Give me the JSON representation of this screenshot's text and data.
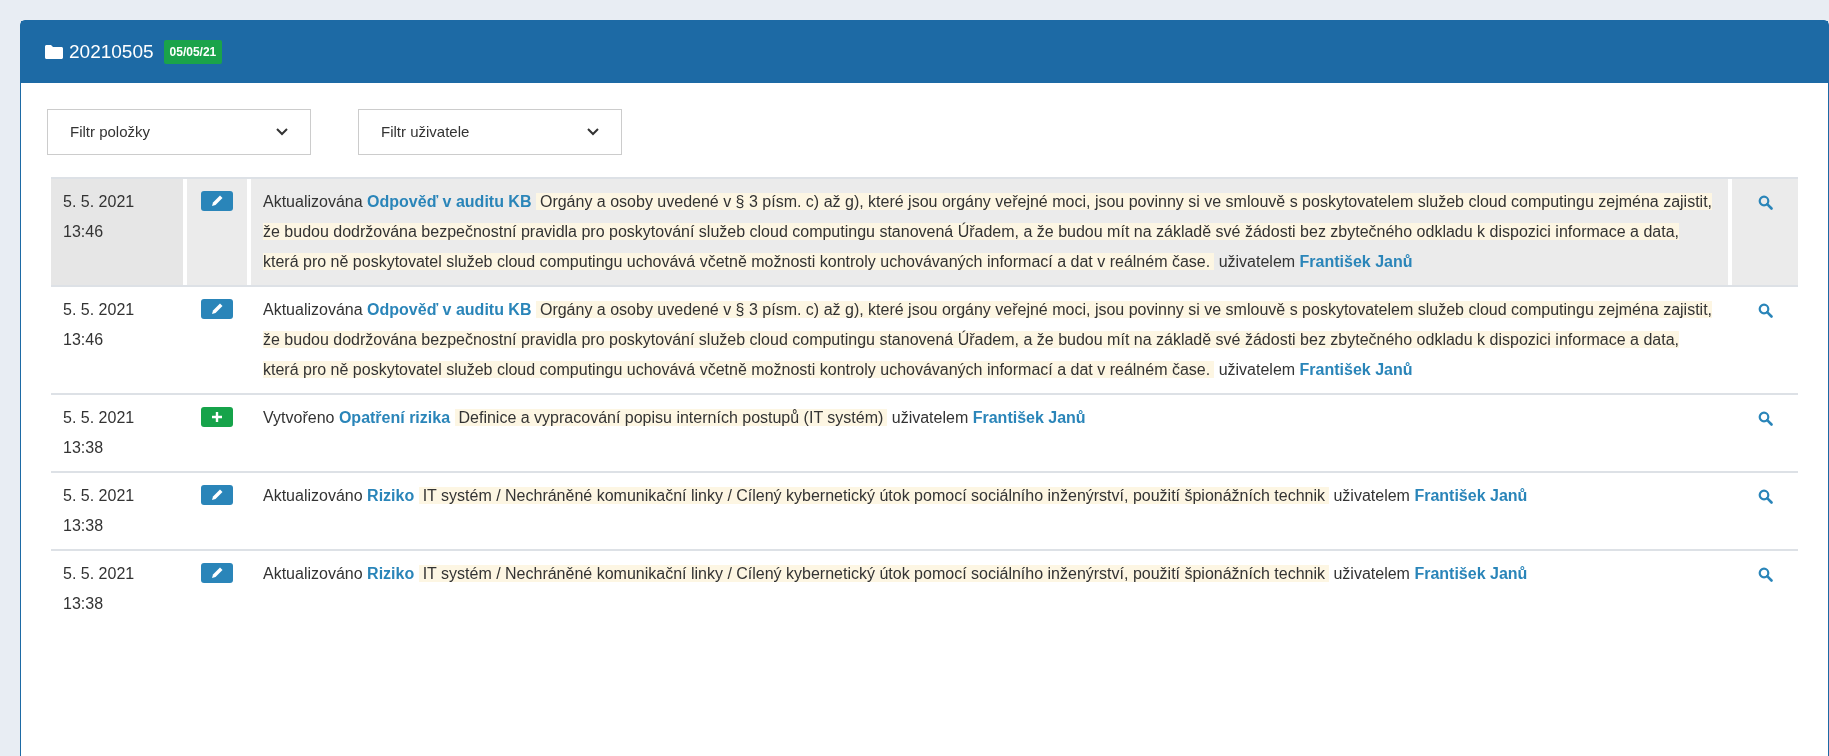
{
  "panel": {
    "title": "20210505",
    "badge": "05/05/21"
  },
  "filters": [
    {
      "placeholder": "Filtr položky"
    },
    {
      "placeholder": "Filtr uživatele"
    }
  ],
  "rows": [
    {
      "date": "5. 5. 2021",
      "time": "13:46",
      "kind": "edit",
      "highlighted": true,
      "action": "Aktualizována",
      "entity": "Odpověď v auditu KB",
      "description": "Orgány a osoby uvedené v § 3 písm. c) až g), které jsou orgány veřejné moci, jsou povinny si ve smlouvě s poskytovatelem služeb cloud computingu zejména zajistit, že budou dodržována bezpečnostní pravidla pro poskytování služeb cloud computingu stanovená Úřadem, a že budou mít na základě své žádosti bez zbytečného odkladu k dispozici informace a data, která pro ně poskytovatel služeb cloud computingu uchovává včetně možnosti kontroly uchovávaných informací a dat v reálném čase.",
      "by": "uživatelem",
      "user": "František Janů"
    },
    {
      "date": "5. 5. 2021",
      "time": "13:46",
      "kind": "edit",
      "highlighted": false,
      "action": "Aktualizována",
      "entity": "Odpověď v auditu KB",
      "description": "Orgány a osoby uvedené v § 3 písm. c) až g), které jsou orgány veřejné moci, jsou povinny si ve smlouvě s poskytovatelem služeb cloud computingu zejména zajistit, že budou dodržována bezpečnostní pravidla pro poskytování služeb cloud computingu stanovená Úřadem, a že budou mít na základě své žádosti bez zbytečného odkladu k dispozici informace a data, která pro ně poskytovatel služeb cloud computingu uchovává včetně možnosti kontroly uchovávaných informací a dat v reálném čase.",
      "by": "uživatelem",
      "user": "František Janů"
    },
    {
      "date": "5. 5. 2021",
      "time": "13:38",
      "kind": "create",
      "highlighted": false,
      "action": "Vytvořeno",
      "entity": "Opatření rizika",
      "description": "Definice a vypracování popisu interních postupů (IT systém)",
      "by": "uživatelem",
      "user": "František Janů"
    },
    {
      "date": "5. 5. 2021",
      "time": "13:38",
      "kind": "edit",
      "highlighted": false,
      "action": "Aktualizováno",
      "entity": "Riziko",
      "description": "IT systém / Nechráněné komunikační linky / Cílený kybernetický útok pomocí sociálního inženýrství, použití špionážních technik",
      "by": "uživatelem",
      "user": "František Janů"
    },
    {
      "date": "5. 5. 2021",
      "time": "13:38",
      "kind": "edit",
      "highlighted": false,
      "action": "Aktualizováno",
      "entity": "Riziko",
      "description": "IT systém / Nechráněné komunikační linky / Cílený kybernetický útok pomocí sociálního inženýrství, použití špionážních technik",
      "by": "uživatelem",
      "user": "František Janů"
    }
  ]
}
